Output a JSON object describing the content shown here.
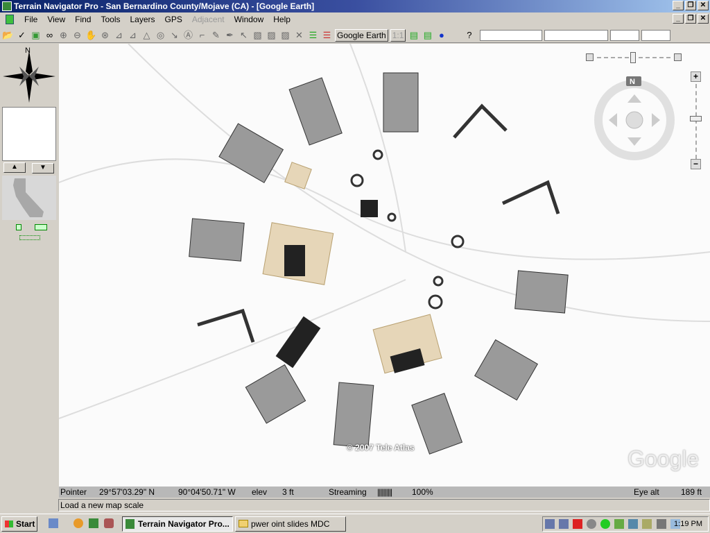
{
  "window": {
    "title": "Terrain Navigator Pro - San Bernardino County/Mojave (CA) - [Google Earth]"
  },
  "menu": [
    {
      "label": "File"
    },
    {
      "label": "View"
    },
    {
      "label": "Find"
    },
    {
      "label": "Tools"
    },
    {
      "label": "Layers"
    },
    {
      "label": "GPS"
    },
    {
      "label": "Adjacent",
      "disabled": true
    },
    {
      "label": "Window"
    },
    {
      "label": "Help"
    }
  ],
  "toolbar": {
    "google_earth_label": "Google Earth",
    "scale_label": "1:1",
    "help_label": "?"
  },
  "sidebar": {
    "north_label": "N"
  },
  "map": {
    "copyright": "© 2007 Tele Atlas",
    "logo": "Google",
    "compass_n": "N"
  },
  "status": {
    "pointer_label": "Pointer",
    "lat": "29°57'03.29\" N",
    "lon": "90°04'50.71\" W",
    "elev_label": "elev",
    "elev": "3 ft",
    "streaming_label": "Streaming",
    "streaming_bar": "||||||||||",
    "streaming_pct": "100%",
    "eye_label": "Eye alt",
    "eye_alt": "189 ft"
  },
  "message": "Load a new map scale",
  "taskbar": {
    "start": "Start",
    "tasks": [
      {
        "label": "Terrain Navigator Pro..."
      },
      {
        "label": "pwer oint slides MDC"
      }
    ],
    "clock": "1:19 PM"
  }
}
